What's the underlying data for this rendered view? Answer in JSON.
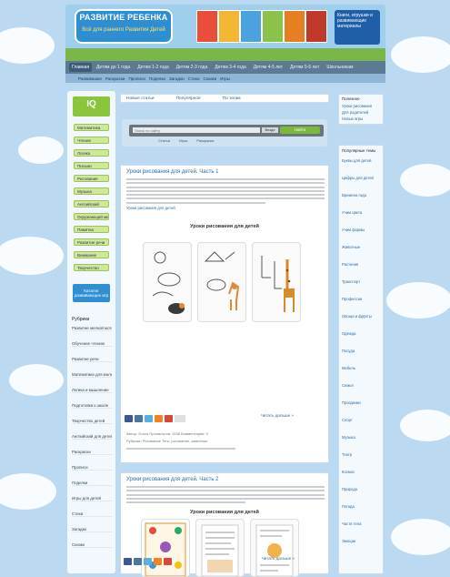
{
  "banner": {
    "logo_title": "РАЗВИТИЕ РЕБЕНКА",
    "logo_subtitle": "Всё для раннего Развития Детей",
    "promo_text": "Книги, игрушки и развивающие материалы"
  },
  "colors": {
    "sky": "#bcd9f2",
    "nav": "#5d7a94",
    "accent_green": "#8ac53b",
    "accent_blue": "#2f8fd1",
    "link": "#2e6ca0"
  },
  "main_nav": [
    "Главная",
    "Детям до 1 года",
    "Детям 1-2 года",
    "Детям 2-3 года",
    "Детям 3-4 года",
    "Детям 4-5 лет",
    "Детям 5-6 лет",
    "Школьникам"
  ],
  "sub_nav": [
    "Развивашки",
    "Раскраски",
    "Прописи",
    "Поделки",
    "Загадки",
    "Стихи",
    "Сказки",
    "Игры"
  ],
  "left": {
    "logo_text": "IQ",
    "buttons": [
      "Математика",
      "Чтение",
      "Логика",
      "Письмо",
      "Рисование",
      "Музыка",
      "Английский",
      "Окружающий мир",
      "Памятка",
      "Развитие речи",
      "Внимание",
      "Творчество"
    ],
    "blue_button": "Каталог развивающих игр",
    "menu_head": "Рубрики",
    "menu_items": [
      "Развитие мелкой моторики",
      "Обучение чтению",
      "Развитие речи",
      "Математика для малышей",
      "Логика и мышление",
      "Подготовка к школе",
      "Творчество детей",
      "Английский для детей",
      "Раскраски",
      "Прописи",
      "Поделки",
      "Игры для детей",
      "Стихи",
      "Загадки",
      "Сказки"
    ]
  },
  "tabs": [
    "Новые статьи",
    "Популярное",
    "По тегам"
  ],
  "search": {
    "placeholder": "Поиск по сайту",
    "select": "Везде",
    "button": "Найти",
    "options": [
      "Статьи",
      "Игры",
      "Раскраски"
    ]
  },
  "articles": [
    {
      "title": "Уроки рисования для детей. Часть 1",
      "link": "Уроки рисования для детей",
      "inner_title": "Уроки рисования для детей",
      "more": "Читать дальше »",
      "meta_1": "Автор: Ольга   Просмотров: 1536   Комментарии: 0",
      "meta_2": "Рубрика: Рисование   Теги: рисование, животные"
    },
    {
      "title": "Уроки рисования для детей. Часть 2",
      "inner_title": "Уроки рисования для детей",
      "more": "Читать дальше »"
    }
  ],
  "right": {
    "box1_head": "Полезное",
    "box1_items": [
      "Уроки рисования",
      "Для родителей",
      "Новые игры"
    ],
    "box2_head": "Популярные темы",
    "box2_items": [
      "Буквы для детей",
      "Цифры для детей",
      "Времена года",
      "Учим цвета",
      "Учим формы",
      "Животные",
      "Растения",
      "Транспорт",
      "Профессии",
      "Овощи и фрукты",
      "Одежда",
      "Посуда",
      "Мебель",
      "Семья",
      "Праздники",
      "Спорт",
      "Музыка",
      "Театр",
      "Космос",
      "Природа",
      "Погода",
      "Части тела",
      "Эмоции"
    ]
  }
}
